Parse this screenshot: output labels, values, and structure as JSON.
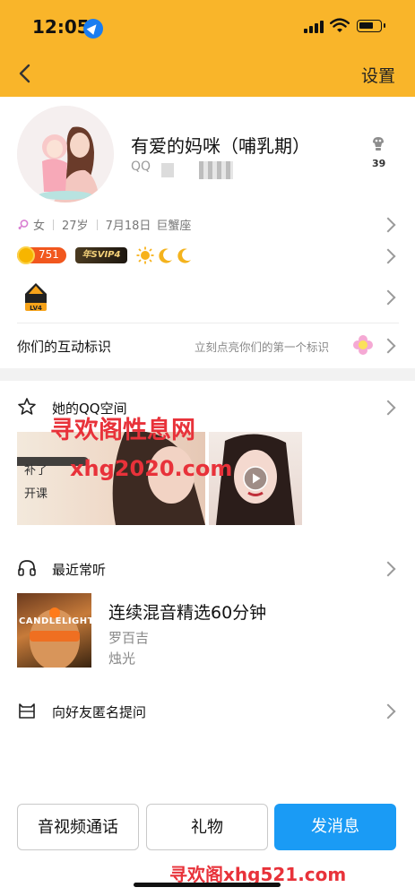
{
  "status_bar": {
    "time": "12:05"
  },
  "nav": {
    "settings_label": "设置"
  },
  "profile": {
    "nickname": "有爱的妈咪（哺乳期）",
    "qq_label": "QQ",
    "like_count": "39",
    "gender": "女",
    "age": "27岁",
    "birthday": "7月18日",
    "zodiac": "巨蟹座",
    "level_number": "751",
    "svip_badge": "年SVIP4",
    "game_level": "LV4",
    "interact_label": "你们的互动标识",
    "interact_hint": "立刻点亮你们的第一个标识"
  },
  "qzone": {
    "title": "她的QQ空间",
    "photo1_text_a": "补了",
    "photo1_text_b": "开课"
  },
  "music": {
    "section_title": "最近常听",
    "song_title": "连续混音精选60分钟",
    "artist": "罗百吉",
    "album": "烛光",
    "cover_text": "CANDLELIGHT"
  },
  "anon_question": {
    "title": "向好友匿名提问"
  },
  "actions": {
    "av_call": "音视频通话",
    "gift": "礼物",
    "send_message": "发消息"
  },
  "watermarks": {
    "line1": "寻欢阁性息网",
    "line2": "xhg2020.com",
    "line3": "寻欢阁xhg521.com"
  },
  "colors": {
    "header_bg": "#f9b52a",
    "primary_button": "#1a9bf5",
    "watermark": "#e8323a"
  }
}
